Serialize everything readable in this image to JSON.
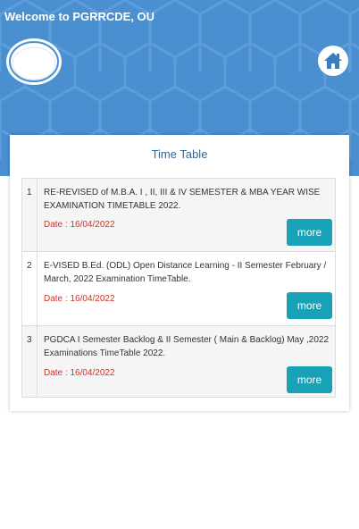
{
  "header": {
    "welcome": "Welcome to PGRRCDE, OU",
    "home_icon": "home-icon",
    "logo_icon": "university-logo"
  },
  "panel": {
    "title": "Time Table"
  },
  "timetables": [
    {
      "number": "1",
      "description": "RE-REVISED of M.B.A. I , II, III & IV SEMESTER & MBA YEAR WISE EXAMINATION TIMETABLE 2022.",
      "date": "Date : 16/04/2022",
      "more_label": "more"
    },
    {
      "number": "2",
      "description": "E-VISED B.Ed. (ODL) Open Distance Learning - II Semester February / March, 2022 Examination TimeTable.",
      "date": "Date : 16/04/2022",
      "more_label": "more"
    },
    {
      "number": "3",
      "description": "PGDCA I Semester Backlog & II Semester ( Main & Backlog) May ,2022 Examinations TimeTable 2022.",
      "date": "Date : 16/04/2022",
      "more_label": "more"
    }
  ],
  "colors": {
    "header_bg": "#4a8fd0",
    "title": "#336699",
    "date": "#d93025",
    "button": "#17a2b8"
  }
}
